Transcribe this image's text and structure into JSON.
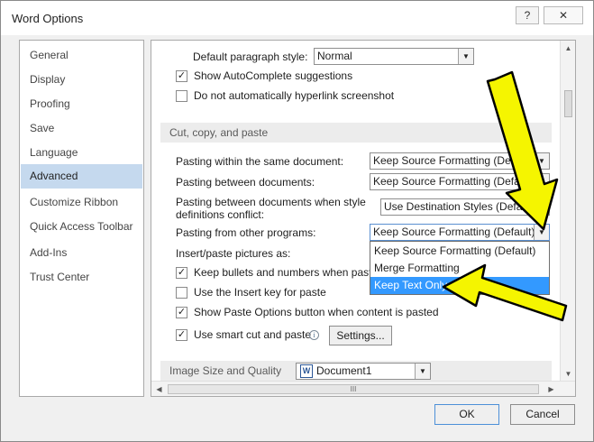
{
  "window": {
    "title": "Word Options",
    "help_glyph": "?",
    "close_glyph": "✕"
  },
  "nav": {
    "items": [
      {
        "label": "General"
      },
      {
        "label": "Display"
      },
      {
        "label": "Proofing"
      },
      {
        "label": "Save"
      },
      {
        "label": "Language"
      },
      {
        "label": "Advanced",
        "selected": true
      },
      {
        "label": "Customize Ribbon"
      },
      {
        "label": "Quick Access Toolbar"
      },
      {
        "label": "Add-Ins"
      },
      {
        "label": "Trust Center"
      }
    ]
  },
  "editing": {
    "default_paragraph_style_label": "Default paragraph style:",
    "default_paragraph_style_value": "Normal",
    "autocomplete_label": "Show AutoComplete suggestions",
    "autocomplete_checked": true,
    "no_hyperlink_label": "Do not automatically hyperlink screenshot",
    "no_hyperlink_checked": false
  },
  "cut_copy_paste": {
    "header": "Cut, copy, and paste",
    "within_doc_label": "Pasting within the same document:",
    "within_doc_value": "Keep Source Formatting (Default)",
    "between_docs_label": "Pasting between documents:",
    "between_docs_value": "Keep Source Formatting (Default)",
    "style_conflict_label_line1": "Pasting between documents when style",
    "style_conflict_label_line2": "definitions conflict:",
    "style_conflict_value": "Use Destination Styles (Default)",
    "other_programs_label": "Pasting from other programs:",
    "other_programs_value": "Keep Source Formatting (Default)",
    "insert_pictures_label": "Insert/paste pictures as:",
    "keep_bullets_label": "Keep bullets and numbers when paste",
    "keep_bullets_checked": true,
    "insert_key_label": "Use the Insert key for paste",
    "insert_key_checked": false,
    "show_paste_options_label": "Show Paste Options button when content is pasted",
    "show_paste_options_checked": true,
    "smart_cut_label": "Use smart cut and paste",
    "smart_cut_checked": true,
    "settings_button": "Settings..."
  },
  "dropdown": {
    "options": [
      {
        "label": "Keep Source Formatting (Default)"
      },
      {
        "label": "Merge Formatting"
      },
      {
        "label": "Keep Text Only",
        "selected": true
      }
    ]
  },
  "image_size": {
    "header": "Image Size and Quality",
    "document_value": "Document1"
  },
  "footer": {
    "ok_label": "OK",
    "cancel_label": "Cancel"
  },
  "colors": {
    "selection_blue": "#3399ff",
    "nav_selected": "#c5d9ee",
    "arrow_yellow": "#f5f500",
    "arrow_outline": "#000000"
  },
  "icons": {
    "checkmark": "✓",
    "dropdown_arrow": "▼",
    "info": "i",
    "scroll_up": "▲",
    "scroll_down": "▼",
    "scroll_left": "◀",
    "scroll_right": "▶",
    "grip": "III",
    "doc": "W"
  }
}
